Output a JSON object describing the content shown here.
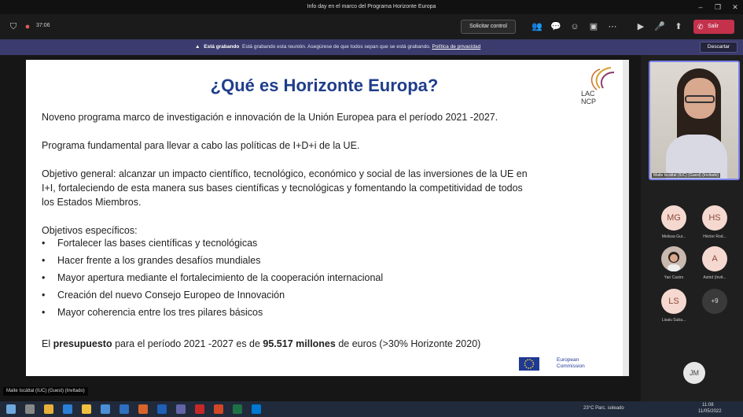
{
  "window": {
    "title": "Info day en el marco del Programa Horizonte Europa"
  },
  "toolbar": {
    "timer": "37:06",
    "request_control": "Solicitar control",
    "leave": "Salir"
  },
  "banner": {
    "title": "Está grabando",
    "message": "Está grabando esta reunión. Asegúrese de que todos sepan que se está grabando.",
    "link": "Política de privacidad",
    "dismiss": "Descartar"
  },
  "slide": {
    "title": "¿Qué es Horizonte Europa?",
    "logo_text_1": "LAC",
    "logo_text_2": "NCP",
    "p1": "Noveno programa marco de investigación e innovación de la Unión Europea para el período 2021 -2027.",
    "p2": "Programa fundamental para llevar a cabo las políticas de I+D+i de la UE.",
    "p3_l1": "Objetivo general: alcanzar un impacto científico, tecnológico, económico y social de las inversiones  de la  UE en",
    "p3_l2": "I+I, fortaleciendo de esta manera sus bases científicas y tecnológicas y fomentando la competitividad de  todos",
    "p3_l3": "los Estados Miembros.",
    "specific_heading": "Objetivos específicos:",
    "bullet_char": "•",
    "bullets": [
      "Fortalecer las bases científicas y tecnológicas",
      "Hacer frente a los grandes desafíos mundiales",
      "Mayor apertura mediante el fortalecimiento de la cooperación internacional",
      "Creación del nuevo Consejo Europeo de Innovación",
      "Mayor coherencia entre los tres pilares básicos"
    ],
    "budget_pre": "El ",
    "budget_b1": "presupuesto",
    "budget_mid": " para el período 2021 -2027 es de ",
    "budget_b2": "95.517 millones",
    "budget_post": " de euros (>30% Horizonte 2020)",
    "ec_line1": "European",
    "ec_line2": "Commission"
  },
  "presenter_tag": "Maite Iscáttal (IUC) (Guest) (Invitado)",
  "participants": {
    "video_label": "Maite Iscáttal (IUC) (Guest) (Invitado)",
    "people": [
      {
        "initials": "MG",
        "name": "Melissa Gui..."
      },
      {
        "initials": "HS",
        "name": "Héctor Rod..."
      },
      {
        "initials": "",
        "name": "Yari Castro"
      },
      {
        "initials": "A",
        "name": "Astrid (Invit..."
      },
      {
        "initials": "LS",
        "name": "Lisaiu Suba..."
      },
      {
        "initials": "+9",
        "name": ""
      },
      {
        "initials": "JM",
        "name": ""
      }
    ]
  },
  "taskbar": {
    "weather": "23°C  Parc. soleado",
    "time": "11:08",
    "date": "11/05/2022"
  },
  "colors": {
    "slide_title": "#1f3d8a",
    "banner": "#3b3b6d",
    "leave": "#c4314b",
    "active_speaker": "#7b83eb"
  }
}
